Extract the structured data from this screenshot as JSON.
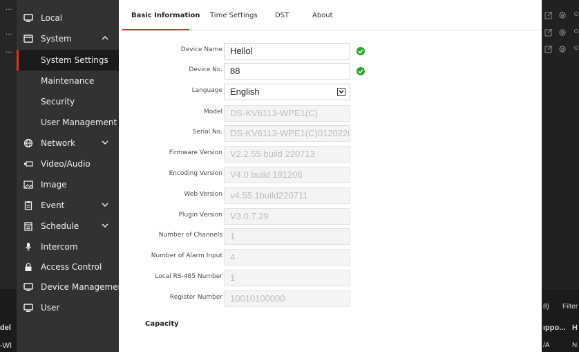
{
  "background_left": {
    "dots": [
      "...",
      "...",
      "..."
    ],
    "col_header": "del",
    "row_value": "-WI"
  },
  "sidebar": {
    "items": [
      {
        "label": "Local",
        "icon": "monitor-icon"
      },
      {
        "label": "System",
        "icon": "window-icon",
        "expanded": true,
        "children": [
          {
            "label": "System Settings",
            "active": true
          },
          {
            "label": "Maintenance"
          },
          {
            "label": "Security"
          },
          {
            "label": "User Management"
          }
        ]
      },
      {
        "label": "Network",
        "icon": "globe-icon"
      },
      {
        "label": "Video/Audio",
        "icon": "camera-icon"
      },
      {
        "label": "Image",
        "icon": "image-icon"
      },
      {
        "label": "Event",
        "icon": "clipboard-icon"
      },
      {
        "label": "Schedule",
        "icon": "calendar-icon"
      },
      {
        "label": "Intercom",
        "icon": "microphone-icon"
      },
      {
        "label": "Access Control",
        "icon": "lock-icon"
      },
      {
        "label": "Device Management",
        "icon": "monitor-icon"
      },
      {
        "label": "User",
        "icon": "monitor-icon"
      }
    ]
  },
  "tabs": [
    {
      "label": "Basic Information",
      "active": true
    },
    {
      "label": "Time Settings"
    },
    {
      "label": "DST"
    },
    {
      "label": "About"
    }
  ],
  "form": {
    "device_name": {
      "label": "Device Name",
      "value": "Hellol",
      "status": "ok"
    },
    "device_no": {
      "label": "Device No.",
      "value": "88",
      "status": "ok"
    },
    "language": {
      "label": "Language",
      "value": "English"
    },
    "model": {
      "label": "Model",
      "value": "DS-KV6113-WPE1(C)"
    },
    "serial_no": {
      "label": "Serial No.",
      "value": "DS-KV6113-WPE1(C)0120220"
    },
    "firmware_version": {
      "label": "Firmware Version",
      "value": "V2.2.55 build 220713"
    },
    "encoding_version": {
      "label": "Encoding Version",
      "value": "V4.0 build 181206"
    },
    "web_version": {
      "label": "Web Version",
      "value": "v4.55.1build220711"
    },
    "plugin_version": {
      "label": "Plugin Version",
      "value": "V3.0.7.29"
    },
    "channels": {
      "label": "Number of Channels",
      "value": "1"
    },
    "alarm_input": {
      "label": "Number of Alarm Input",
      "value": "4"
    },
    "rs485": {
      "label": "Local RS-485 Number",
      "value": "1"
    },
    "register_number": {
      "label": "Register Number",
      "value": "10010100000"
    }
  },
  "capacity_title": "Capacity",
  "background_right": {
    "count_text": "8)",
    "filter_placeholder": "Filter",
    "col_header_1": "ıppo...",
    "col_header_2": "H",
    "row_value_1": "/A",
    "row_value_2": "N"
  },
  "colors": {
    "accent": "#e0322b",
    "ok_green": "#2aa52a",
    "sidebar_bg": "#323232"
  }
}
